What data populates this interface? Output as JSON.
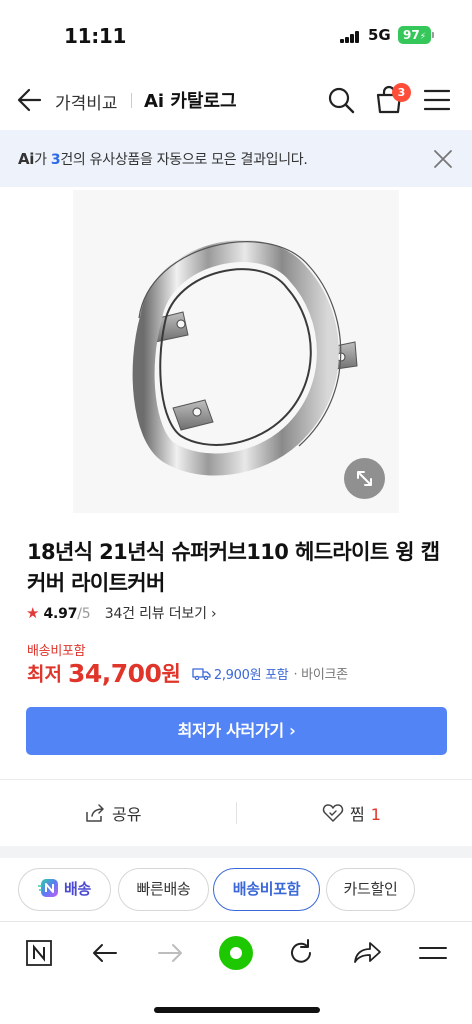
{
  "status_bar": {
    "time": "11:11",
    "network": "5G",
    "battery": "97"
  },
  "header": {
    "title_plain": "가격비교",
    "title_bold": "Ai 카탈로그",
    "cart_count": "3"
  },
  "ai_banner": {
    "logo": "Ai",
    "text_before": "가 ",
    "count": "3",
    "text_after": "건의 유사상품을 자동으로 모은 결과입니다."
  },
  "product": {
    "title": "18년식 21년식 슈퍼커브110 헤드라이트 윙 캡 커버 라이트커버",
    "rating_star": "★",
    "rating": "4.97",
    "rating_max": "/5",
    "review_link": "34건 리뷰 더보기 ›",
    "shipping_included": "배송비포함",
    "price_prefix": "최저",
    "price": "34,700",
    "price_unit": "원",
    "shipping_fee": "2,900원 포함",
    "seller": "· 바이크존",
    "buy_button": "최저가 사러가기 ›"
  },
  "actions": {
    "share": "공유",
    "like": "찜",
    "like_count": "1"
  },
  "filter_chips": {
    "npay": "배송",
    "fast": "빠른배송",
    "free_shipping": "배송비포함",
    "card": "카드할인"
  },
  "colors": {
    "accent_blue": "#5384f5",
    "price_red": "#e0352b",
    "banner_bg": "#eef3fb",
    "battery_green": "#35c759",
    "chip_active": "#3b68d8",
    "naver_green": "#1ec800"
  },
  "icons": {
    "back": "arrow-left-icon",
    "search": "search-icon",
    "cart": "shopping-bag-icon",
    "menu": "hamburger-icon",
    "close": "close-icon",
    "zoom": "expand-icon",
    "share": "share-icon",
    "like": "heart-icon",
    "truck": "truck-icon",
    "nav_n": "naver-n-icon",
    "nav_back": "arrow-left-icon",
    "nav_forward": "arrow-right-icon",
    "nav_home": "green-dot-icon",
    "nav_reload": "reload-icon",
    "nav_share": "share-arrow-icon",
    "nav_menu": "menu-icon"
  }
}
